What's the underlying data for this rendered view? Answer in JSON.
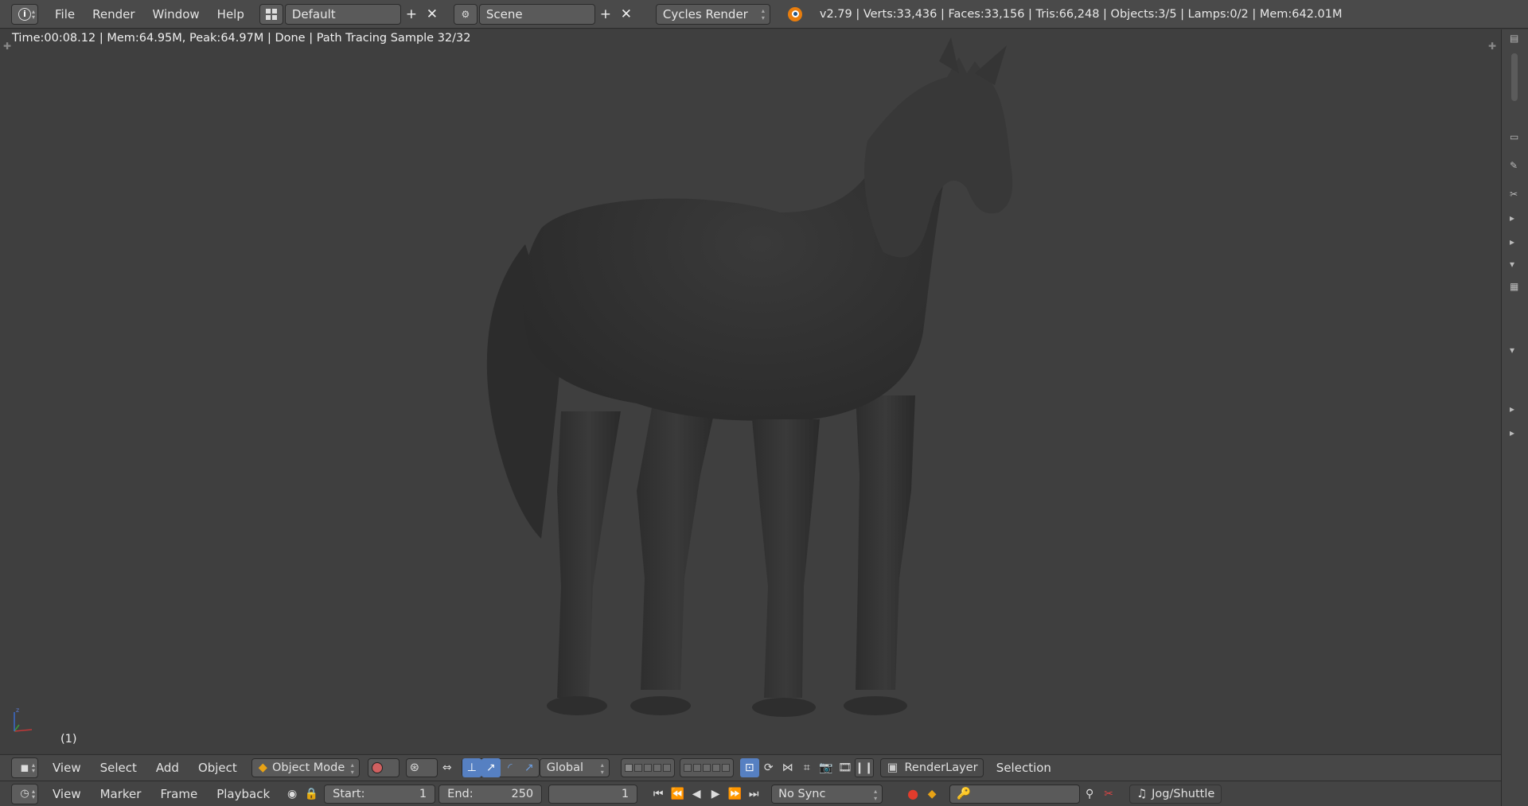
{
  "topbar": {
    "menu": [
      "File",
      "Render",
      "Window",
      "Help"
    ],
    "screen_layout": "Default",
    "scene": "Scene",
    "render_engine": "Cycles Render",
    "stats": "v2.79 | Verts:33,436 | Faces:33,156 | Tris:66,248 | Objects:3/5 | Lamps:0/2 | Mem:642.01M"
  },
  "viewport": {
    "render_info": "Time:00:08.12 | Mem:64.95M, Peak:64.97M | Done | Path Tracing Sample 32/32",
    "frame_indicator": "(1)"
  },
  "header3d": {
    "menu": [
      "View",
      "Select",
      "Add",
      "Object"
    ],
    "mode": "Object Mode",
    "orientation": "Global",
    "render_layer": "RenderLayer",
    "selection": "Selection"
  },
  "timeline": {
    "menu": [
      "View",
      "Marker",
      "Frame",
      "Playback"
    ],
    "start_label": "Start:",
    "start_value": "1",
    "end_label": "End:",
    "end_value": "250",
    "current_frame": "1",
    "sync": "No Sync",
    "keying": "Jog/Shuttle"
  },
  "colors": {
    "accent": "#5680c2",
    "record": "#e23c2c",
    "keyframe": "#e8a316"
  }
}
